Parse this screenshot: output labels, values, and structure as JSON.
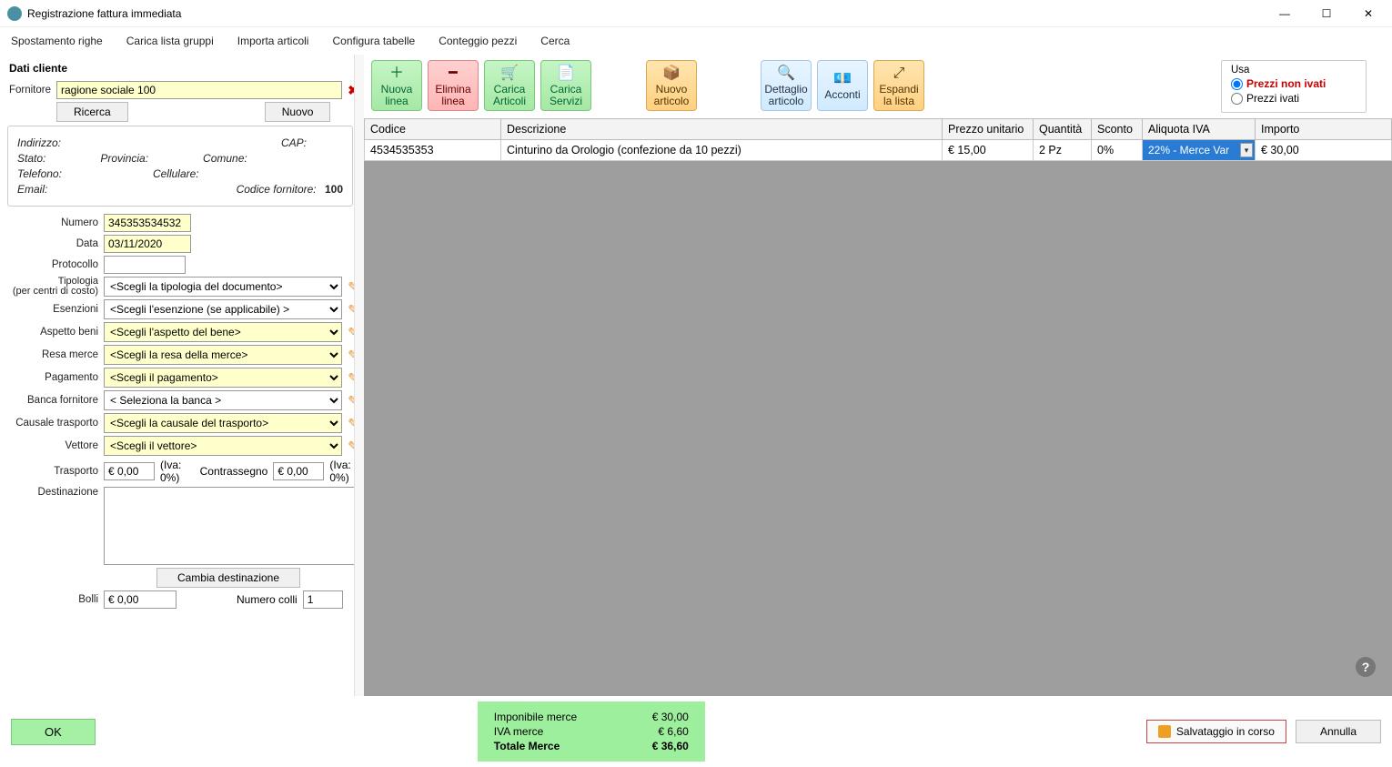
{
  "window": {
    "title": "Registrazione fattura immediata"
  },
  "menu": [
    "Spostamento righe",
    "Carica lista gruppi",
    "Importa articoli",
    "Configura tabelle",
    "Conteggio pezzi",
    "Cerca"
  ],
  "client": {
    "heading": "Dati cliente",
    "fornitore_label": "Fornitore",
    "fornitore_value": "ragione sociale 100",
    "ricerca_btn": "Ricerca",
    "nuovo_btn": "Nuovo",
    "indirizzo_lab": "Indirizzo:",
    "cap_lab": "CAP:",
    "stato_lab": "Stato:",
    "provincia_lab": "Provincia:",
    "comune_lab": "Comune:",
    "telefono_lab": "Telefono:",
    "cellulare_lab": "Cellulare:",
    "email_lab": "Email:",
    "cod_for_lab": "Codice fornitore:",
    "cod_for_val": "100"
  },
  "form": {
    "numero_label": "Numero",
    "numero_value": "345353534532",
    "data_label": "Data",
    "data_value": "03/11/2020",
    "protocollo_label": "Protocollo",
    "protocollo_value": "",
    "tipologia_label": "Tipologia\n(per centri di costo)",
    "tipologia_ph": "<Scegli la tipologia del documento>",
    "esenzioni_label": "Esenzioni",
    "esenzioni_ph": "<Scegli l'esenzione (se applicabile) >",
    "aspetto_label": "Aspetto beni",
    "aspetto_ph": "<Scegli l'aspetto del bene>",
    "resa_label": "Resa merce",
    "resa_ph": "<Scegli la resa della merce>",
    "pagamento_label": "Pagamento",
    "pagamento_ph": "<Scegli il pagamento>",
    "banca_label": "Banca fornitore",
    "banca_ph": "< Seleziona la banca >",
    "causale_label": "Causale trasporto",
    "causale_ph": "<Scegli la causale del trasporto>",
    "vettore_label": "Vettore",
    "vettore_ph": "<Scegli il vettore>",
    "trasporto_label": "Trasporto",
    "trasporto_val": "€ 0,00",
    "trasporto_iva": "(Iva: 0%)",
    "contr_label": "Contrassegno",
    "contr_val": "€ 0,00",
    "contr_iva": "(Iva: 0%)",
    "dest_label": "Destinazione",
    "cambia_dest_btn": "Cambia destinazione",
    "bolli_label": "Bolli",
    "bolli_val": "€ 0,00",
    "colli_label": "Numero colli",
    "colli_val": "1"
  },
  "toolbar": {
    "nuova_linea": "Nuova linea",
    "elimina_linea": "Elimina linea",
    "carica_articoli": "Carica Articoli",
    "carica_servizi": "Carica Servizi",
    "nuovo_articolo": "Nuovo articolo",
    "dettaglio_articolo": "Dettaglio articolo",
    "acconti": "Acconti",
    "espandi_lista": "Espandi la lista"
  },
  "usa": {
    "title": "Usa",
    "non_ivati": "Prezzi non ivati",
    "ivati": "Prezzi ivati"
  },
  "grid": {
    "headers": [
      "Codice",
      "Descrizione",
      "Prezzo unitario",
      "Quantità",
      "Sconto",
      "Aliquota IVA",
      "Importo"
    ],
    "rows": [
      {
        "codice": "4534535353",
        "descr": "Cinturino da Orologio (confezione da 10 pezzi)",
        "prezzo": "€ 15,00",
        "qta": "2 Pz",
        "sconto": "0%",
        "iva": "22% - Merce Var",
        "importo": "€ 30,00"
      }
    ]
  },
  "totals": {
    "imp_lab": "Imponibile merce",
    "imp_val": "€ 30,00",
    "iva_lab": "IVA merce",
    "iva_val": "€ 6,60",
    "tot_lab": "Totale Merce",
    "tot_val": "€ 36,60"
  },
  "footer": {
    "ok": "OK",
    "save": "Salvataggio in corso",
    "annulla": "Annulla"
  }
}
